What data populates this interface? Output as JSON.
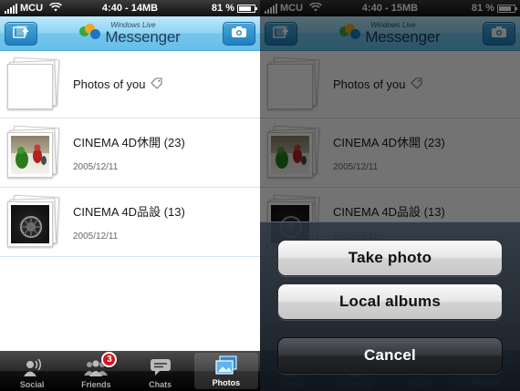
{
  "status_bar": {
    "carrier": "MCU",
    "time_left": "4:40 - 14MB",
    "time_right": "4:40 - 15MB",
    "battery": "81 %",
    "battery_level": 0.81
  },
  "header": {
    "brand_small": "Windows Live",
    "brand_large": "Messenger",
    "add_icon": "add-photo-icon",
    "camera_icon": "camera-icon"
  },
  "albums": [
    {
      "title": "Photos of you",
      "date": "",
      "icon": "tag-icon"
    },
    {
      "title": "CINEMA 4D休開 (23)",
      "date": "2005/12/11"
    },
    {
      "title": "CINEMA 4D品設 (13)",
      "date": "2005/12/11"
    }
  ],
  "tabs": [
    {
      "label": "Social",
      "icon": "social-icon"
    },
    {
      "label": "Friends",
      "icon": "friends-icon",
      "badge": "3"
    },
    {
      "label": "Chats",
      "icon": "chat-bubble-icon"
    },
    {
      "label": "Photos",
      "icon": "photos-icon",
      "active": true
    }
  ],
  "action_sheet": {
    "take_photo": "Take photo",
    "local_albums": "Local albums",
    "cancel": "Cancel"
  },
  "colors": {
    "nav_blue": "#74c5ec",
    "nav_button": "#1f7fbf",
    "badge_red": "#d7121b"
  }
}
